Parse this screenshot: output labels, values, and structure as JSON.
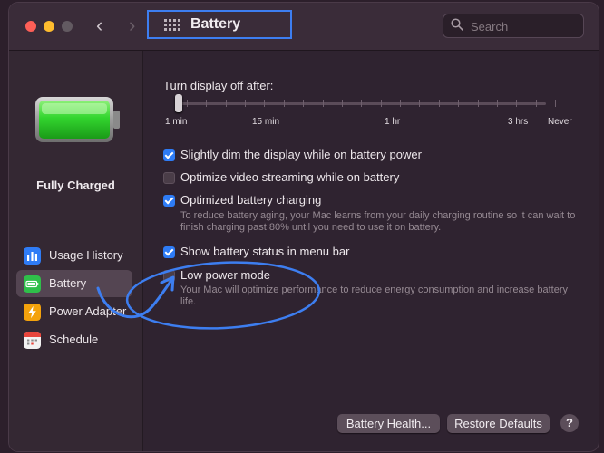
{
  "window": {
    "title": "Battery",
    "search_placeholder": "Search",
    "nav_back": "‹",
    "nav_forward": "›"
  },
  "sidebar": {
    "status": "Fully Charged",
    "items": [
      {
        "label": "Usage History",
        "icon": "bar-chart-icon",
        "color": "#2f7cf6"
      },
      {
        "label": "Battery",
        "icon": "battery-icon",
        "color": "#2fbf4a"
      },
      {
        "label": "Power Adapter",
        "icon": "bolt-icon",
        "color": "#f4a20c"
      },
      {
        "label": "Schedule",
        "icon": "calendar-icon",
        "color": "#f2f2f2"
      }
    ],
    "selected": "Battery"
  },
  "main": {
    "slider_label": "Turn display off after:",
    "slider_value": "1 min",
    "slider_ticks": [
      "1 min",
      "15 min",
      "1 hr",
      "3 hrs",
      "Never"
    ],
    "options": [
      {
        "label": "Slightly dim the display while on battery power",
        "checked": true
      },
      {
        "label": "Optimize video streaming while on battery",
        "checked": false
      },
      {
        "label": "Optimized battery charging",
        "checked": true,
        "help": "To reduce battery aging, your Mac learns from your daily charging routine so it can wait to finish charging past 80% until you need to use it on battery."
      },
      {
        "label": "Show battery status in menu bar",
        "checked": true
      },
      {
        "label": "Low power mode",
        "checked": false,
        "help": "Your Mac will optimize performance to reduce energy consumption and increase battery life."
      }
    ]
  },
  "footer": {
    "battery_health": "Battery Health...",
    "restore_defaults": "Restore Defaults",
    "help": "?"
  },
  "colors": {
    "accent": "#2e7cf6",
    "annotation": "#3d7ef0",
    "battery_fill": "#33d62f"
  }
}
